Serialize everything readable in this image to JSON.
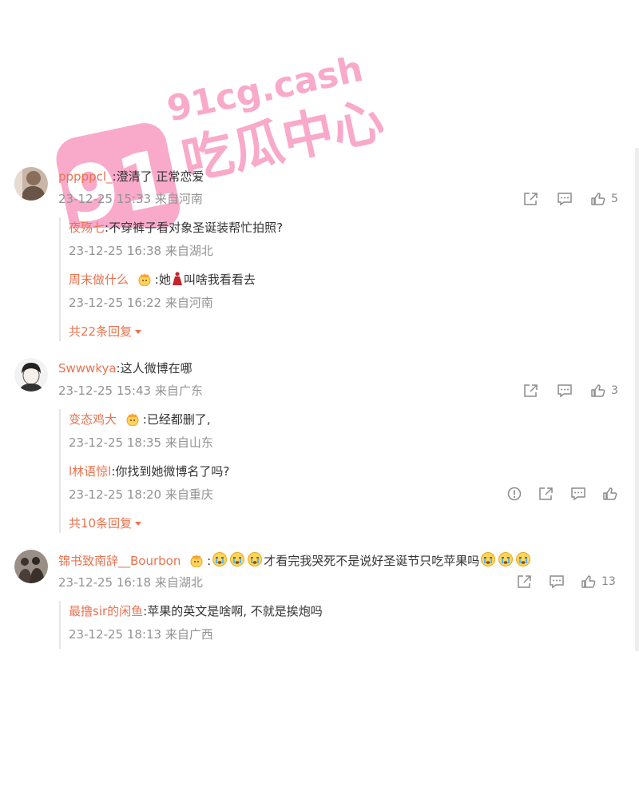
{
  "watermark": {
    "site": "91cg.cash",
    "title": "吃瓜中心",
    "badge": "91"
  },
  "comments": [
    {
      "user": "pppppcl_",
      "text": ":澄清了 正常恋爱",
      "meta": "23-12-25 15:33 来自河南",
      "likes": "5",
      "replies": [
        {
          "user": "夜殇七",
          "text": ":不穿裤子看对象圣诞装帮忙拍照?",
          "meta": "23-12-25 16:38 来自湖北"
        },
        {
          "user": "周末做什么",
          "text": ":她",
          "text2": "叫啥我看看去",
          "meta": "23-12-25 16:22 来自河南"
        }
      ],
      "more": "共22条回复"
    },
    {
      "user": "Swwwkya",
      "text": ":这人微博在哪",
      "meta": "23-12-25 15:43 来自广东",
      "likes": "3",
      "replies": [
        {
          "user": "变态鸡大",
          "text": ":已经都删了,",
          "meta": "23-12-25 18:35 来自山东"
        },
        {
          "user": "l林语惊l",
          "text": ":你找到她微博名了吗?",
          "meta": "23-12-25 18:20 来自重庆"
        }
      ],
      "more": "共10条回复"
    },
    {
      "user": "锦书致南辞__Bourbon",
      "text": "才看完我哭死不是说好圣诞节只吃苹果吗",
      "meta": "23-12-25 16:18 来自湖北",
      "likes": "13",
      "replies": [
        {
          "user": "最撸sir的闲鱼",
          "text": ":苹果的英文是啥啊, 不就是挨炮吗",
          "meta": "23-12-25 18:13 来自广西"
        }
      ]
    }
  ],
  "colors": {
    "username": "#eb7350",
    "meta": "#939393",
    "text": "#333333",
    "watermark": "#f9a9c9"
  }
}
